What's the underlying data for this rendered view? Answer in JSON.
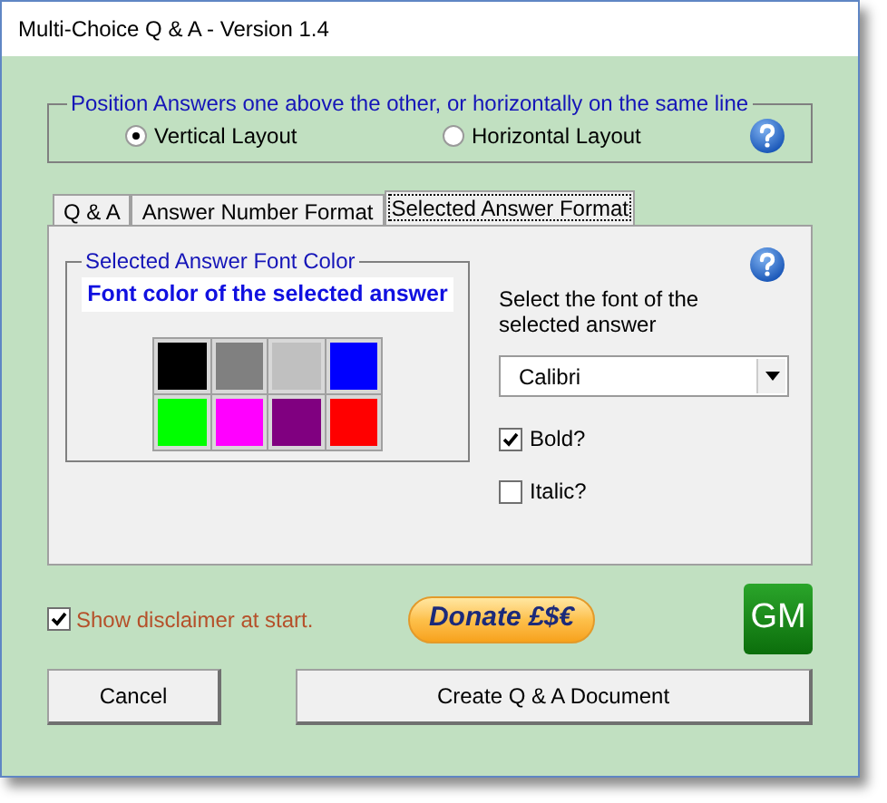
{
  "window": {
    "title": "Multi-Choice Q & A - Version 1.4"
  },
  "layout_group": {
    "legend": "Position Answers one above the other, or horizontally on the same line",
    "options": [
      {
        "label": "Vertical Layout",
        "selected": true
      },
      {
        "label": "Horizontal Layout",
        "selected": false
      }
    ]
  },
  "tabs": [
    {
      "label": "Q & A",
      "selected": false
    },
    {
      "label": "Answer Number Format",
      "selected": false
    },
    {
      "label": "Selected Answer Format",
      "selected": true
    }
  ],
  "color_group": {
    "legend": "Selected Answer Font Color",
    "preview": "Font color of the selected answer",
    "swatches": [
      {
        "color": "#000000"
      },
      {
        "color": "#808080"
      },
      {
        "color": "#c0c0c0"
      },
      {
        "color": "#0000ff"
      },
      {
        "color": "#00ff00"
      },
      {
        "color": "#ff00ff"
      },
      {
        "color": "#800080"
      },
      {
        "color": "#ff0000"
      }
    ]
  },
  "font_select": {
    "label": "Select the font of the selected answer",
    "value": "Calibri"
  },
  "font_options": [
    {
      "label": "Bold?",
      "checked": true
    },
    {
      "label": "Italic?",
      "checked": false
    }
  ],
  "disclaimer": {
    "label": "Show disclaimer at start.",
    "checked": true
  },
  "donate_button": "Donate £$€",
  "logo_text": "GM",
  "buttons": [
    {
      "label": "Cancel"
    },
    {
      "label": "Create Q & A Document"
    }
  ]
}
